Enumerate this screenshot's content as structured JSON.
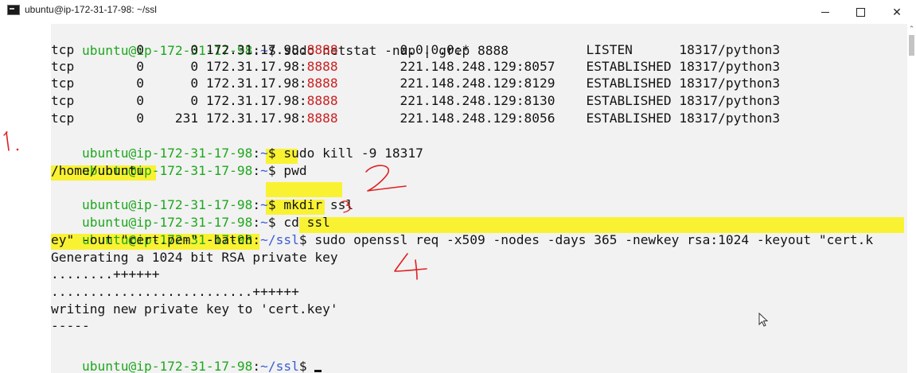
{
  "window": {
    "title": "ubuntu@ip-172-31-17-98: ~/ssl",
    "icon": "terminal-icon",
    "controls": [
      "minimize",
      "maximize",
      "close"
    ]
  },
  "colors": {
    "prompt_user": "#1ea81e",
    "prompt_path": "#3b5bd6",
    "port_highlight": "#cc2020",
    "marker_highlight": "#f9f233",
    "annotation_ink": "#e02020"
  },
  "terminal": {
    "prompt_user": "ubuntu@ip-172-31-17-98",
    "prompt_colon": ":",
    "prompt_dollar": "$ ",
    "cwd_home": "~",
    "cwd_ssl": "~/ssl",
    "cmd_netstat": "sudo netstat -nap | grep 8888",
    "netstat_rows": [
      {
        "pre": "tcp        0      0 172.31.17.98:",
        "port": "8888",
        "post": "        0.0.0.0:*               LISTEN      18317/python3"
      },
      {
        "pre": "tcp        0      0 172.31.17.98:",
        "port": "8888",
        "post": "        221.148.248.129:8057    ESTABLISHED 18317/python3"
      },
      {
        "pre": "tcp        0      0 172.31.17.98:",
        "port": "8888",
        "post": "        221.148.248.129:8129    ESTABLISHED 18317/python3"
      },
      {
        "pre": "tcp        0      0 172.31.17.98:",
        "port": "8888",
        "post": "        221.148.248.129:8130    ESTABLISHED 18317/python3"
      },
      {
        "pre": "tcp        0    231 172.31.17.98:",
        "port": "8888",
        "post": "        221.148.248.129:8056    ESTABLISHED 18317/python3"
      }
    ],
    "cmd_kill": "sudo kill -9 18317",
    "cmd_pwd": "pwd",
    "out_pwd": "/home/ubuntu",
    "cmd_mkdir": "mkdir ssl",
    "cmd_cd": "cd ssl",
    "cmd_openssl_1": "sudo openssl req -x509 -nodes -days 365 -newkey rsa:1024 -keyout \"cert.k",
    "cmd_openssl_2": "ey\" -out \"cert.pem\" -batch",
    "out_generating": "Generating a 1024 bit RSA private key",
    "out_dots_1": "........++++++",
    "out_dots_2": "..........................++++++",
    "out_writing": "writing new private key to 'cert.key'",
    "out_dashes": "-----"
  },
  "annotations": [
    "1.",
    "2",
    "3",
    "4"
  ]
}
